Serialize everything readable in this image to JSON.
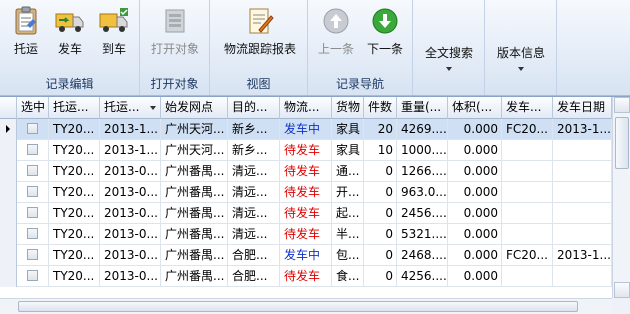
{
  "ribbon": {
    "groups": [
      {
        "label": "记录编辑",
        "buttons": [
          {
            "label": "托运",
            "icon": "clipboard-icon"
          },
          {
            "label": "发车",
            "icon": "truck-icon"
          },
          {
            "label": "到车",
            "icon": "truck-arrive-icon"
          }
        ]
      },
      {
        "label": "打开对象",
        "buttons": [
          {
            "label": "打开对象",
            "icon": "open-object-icon"
          }
        ]
      },
      {
        "label": "视图",
        "buttons": [
          {
            "label": "物流跟踪报表",
            "icon": "report-icon"
          }
        ]
      },
      {
        "label": "记录导航",
        "buttons": [
          {
            "label": "上一条",
            "icon": "up-arrow-icon"
          },
          {
            "label": "下一条",
            "icon": "down-arrow-icon"
          }
        ]
      },
      {
        "label": "",
        "buttons": [
          {
            "label": "全文搜索"
          }
        ]
      },
      {
        "label": "",
        "buttons": [
          {
            "label": "版本信息"
          }
        ]
      }
    ]
  },
  "grid": {
    "columns": [
      "选中",
      "托运...",
      "托运...",
      "始发网点",
      "目的...",
      "物流...",
      "货物",
      "件数",
      "重量(...",
      "体积(...",
      "发车...",
      "发车日期"
    ],
    "rows": [
      {
        "c1": "TY20...",
        "c2": "2013-1...",
        "c3": "广州天河...",
        "c4": "新乡...",
        "c5": "发车中",
        "c6": "家具",
        "c7": "20",
        "c8": "4269....",
        "c9": "0.000",
        "c10": "FC20...",
        "c11": "2013-1..."
      },
      {
        "c1": "TY20...",
        "c2": "2013-1...",
        "c3": "广州天河...",
        "c4": "新乡...",
        "c5": "待发车",
        "c6": "家具",
        "c7": "10",
        "c8": "1000....",
        "c9": "0.000",
        "c10": "",
        "c11": ""
      },
      {
        "c1": "TY20...",
        "c2": "2013-0...",
        "c3": "广州番禺...",
        "c4": "清远...",
        "c5": "待发车",
        "c6": "通...",
        "c7": "0",
        "c8": "1266....",
        "c9": "0.000",
        "c10": "",
        "c11": ""
      },
      {
        "c1": "TY20...",
        "c2": "2013-0...",
        "c3": "广州番禺...",
        "c4": "清远...",
        "c5": "待发车",
        "c6": "开...",
        "c7": "0",
        "c8": "963.0...",
        "c9": "0.000",
        "c10": "",
        "c11": ""
      },
      {
        "c1": "TY20...",
        "c2": "2013-0...",
        "c3": "广州番禺...",
        "c4": "清远...",
        "c5": "待发车",
        "c6": "起...",
        "c7": "0",
        "c8": "2456....",
        "c9": "0.000",
        "c10": "",
        "c11": ""
      },
      {
        "c1": "TY20...",
        "c2": "2013-0...",
        "c3": "广州番禺...",
        "c4": "清远...",
        "c5": "待发车",
        "c6": "半...",
        "c7": "0",
        "c8": "5321....",
        "c9": "0.000",
        "c10": "",
        "c11": ""
      },
      {
        "c1": "TY20...",
        "c2": "2013-0...",
        "c3": "广州番禺...",
        "c4": "合肥...",
        "c5": "发车中",
        "c6": "包...",
        "c7": "0",
        "c8": "2468....",
        "c9": "0.000",
        "c10": "FC20...",
        "c11": "2013-1..."
      },
      {
        "c1": "TY20...",
        "c2": "2013-0...",
        "c3": "广州番禺...",
        "c4": "合肥...",
        "c5": "待发车",
        "c6": "食...",
        "c7": "0",
        "c8": "4256....",
        "c9": "0.000",
        "c10": "",
        "c11": ""
      }
    ]
  },
  "colors": {
    "status_in_transit": "#1030c8",
    "status_waiting": "#e00000",
    "selected_row": "#cfe0f5"
  }
}
